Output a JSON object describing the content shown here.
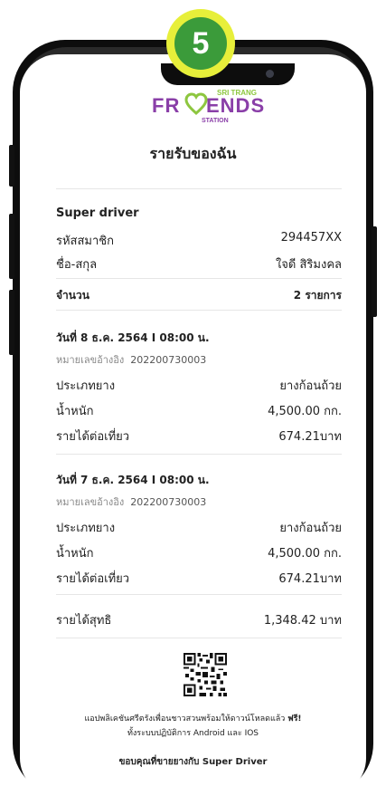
{
  "step": {
    "number": "5"
  },
  "logo": {
    "word_left": "FR",
    "word_right": "ENDS",
    "top_text": "SRI TRANG",
    "bottom_text": "STATION"
  },
  "page": {
    "title": "รายรับของฉัน"
  },
  "member": {
    "role": "Super driver",
    "id_label": "รหัสสมาชิก",
    "id_value": "294457XX",
    "name_label": "ชื่อ-สกุล",
    "name_value": "ใจดี สิริมงคล"
  },
  "summary": {
    "count_label": "จำนวน",
    "count_value": "2 รายการ"
  },
  "transactions": [
    {
      "date": "วันที่  8 ธ.ค. 2564 I 08:00 น.",
      "ref_label": "หมายเลขอ้างอิง",
      "ref_value": "202200730003",
      "type_label": "ประเภทยาง",
      "type_value": "ยางก้อนถ้วย",
      "weight_label": "น้ำหนัก",
      "weight_value": "4,500.00  กก.",
      "income_label": "รายได้ต่อเที่ยว",
      "income_value": "674.21บาท"
    },
    {
      "date": "วันที่  7 ธ.ค. 2564 I 08:00 น.",
      "ref_label": "หมายเลขอ้างอิง",
      "ref_value": "202200730003",
      "type_label": "ประเภทยาง",
      "type_value": "ยางก้อนถ้วย",
      "weight_label": "น้ำหนัก",
      "weight_value": "4,500.00  กก.",
      "income_label": "รายได้ต่อเที่ยว",
      "income_value": "674.21บาท"
    }
  ],
  "total": {
    "label": "รายได้สุทธิ",
    "value": "1,348.42 บาท"
  },
  "footer": {
    "line1": "แอปพลิเคชันศรีตรังเพื่อนชาวสวนพร้อมให้ดาวน์โหลดแล้ว",
    "line1_free": "ฟรี!",
    "line2": "ทั้งระบบปฏิบัติการ Android และ IOS",
    "thanks": "ขอบคุณที่ขายยางกับ  Super Driver"
  },
  "colors": {
    "logo_purple": "#8a3fa8",
    "logo_green": "#8dc63f",
    "badge_green": "#3b9b3a",
    "badge_yellow": "#e7ef3a"
  }
}
